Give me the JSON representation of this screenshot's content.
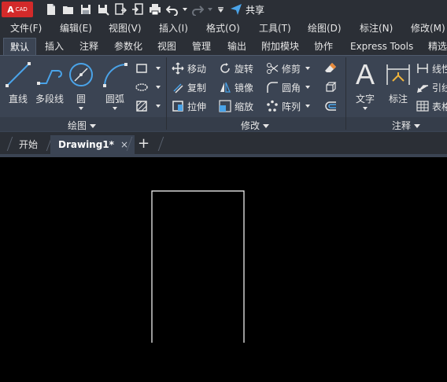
{
  "app": {
    "logo_text": "A",
    "logo_sub": "CAD",
    "share_label": "共享"
  },
  "quick_access": [
    {
      "name": "new-icon"
    },
    {
      "name": "open-icon"
    },
    {
      "name": "save-icon"
    },
    {
      "name": "save-as-icon"
    },
    {
      "name": "export-icon"
    },
    {
      "name": "import-icon"
    },
    {
      "name": "print-icon"
    },
    {
      "name": "undo-icon"
    },
    {
      "name": "redo-icon"
    },
    {
      "name": "customize-icon"
    }
  ],
  "menu": [
    "文件(F)",
    "编辑(E)",
    "视图(V)",
    "插入(I)",
    "格式(O)",
    "工具(T)",
    "绘图(D)",
    "标注(N)",
    "修改(M)"
  ],
  "ribbon_tabs": [
    "默认",
    "插入",
    "注释",
    "参数化",
    "视图",
    "管理",
    "输出",
    "附加模块",
    "协作",
    "Express Tools",
    "精选"
  ],
  "draw_panel": {
    "title": "绘图",
    "line": "直线",
    "polyline": "多段线",
    "circle": "圆",
    "arc": "圆弧"
  },
  "modify_panel": {
    "title": "修改",
    "move": "移动",
    "rotate": "旋转",
    "trim": "修剪",
    "copy": "复制",
    "mirror": "镜像",
    "fillet": "圆角",
    "stretch": "拉伸",
    "scale": "缩放",
    "array": "阵列"
  },
  "annotation_panel": {
    "title": "注释",
    "text": "文字",
    "dimension": "标注",
    "linear": "线性",
    "leader": "引线",
    "table": "表格"
  },
  "file_tabs": {
    "start": "开始",
    "drawing": "Drawing1*",
    "close": "×",
    "new": "+"
  },
  "colors": {
    "chrome_dark": "#2b2f36",
    "ribbon": "#3b4453",
    "logo_red": "#d32a2a",
    "canvas": "#000000",
    "drawing_line": "#ffffff",
    "accent_blue": "#4aa3e8"
  }
}
